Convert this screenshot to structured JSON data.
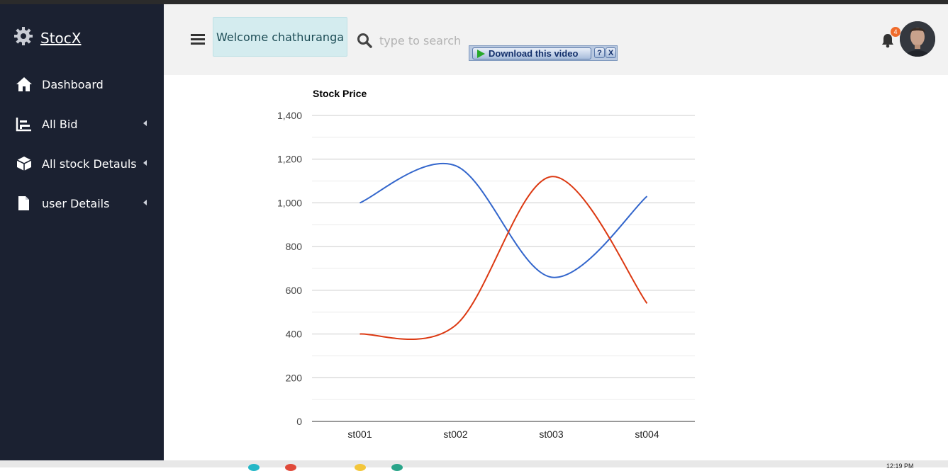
{
  "app": {
    "brand": "StocX"
  },
  "sidebar": {
    "items": [
      {
        "label": "Dashboard",
        "icon": "home-icon",
        "has_caret": false
      },
      {
        "label": "All Bid",
        "icon": "bar-chart-icon",
        "has_caret": true
      },
      {
        "label": "All stock Detauls",
        "icon": "box-icon",
        "has_caret": true
      },
      {
        "label": "user Details",
        "icon": "file-icon",
        "has_caret": true
      }
    ]
  },
  "header": {
    "welcome": "Welcome chathuranga",
    "search_placeholder": "type to search",
    "notification_count": "4"
  },
  "overlay": {
    "download_label": "Download this video",
    "help_label": "?",
    "close_label": "X"
  },
  "chart_data": {
    "type": "line",
    "title": "Stock Price",
    "categories": [
      "st001",
      "st002",
      "st003",
      "st004"
    ],
    "ylim": [
      0,
      1400
    ],
    "yticks": [
      0,
      200,
      400,
      600,
      800,
      1000,
      1200,
      1400
    ],
    "ytick_labels": [
      "0",
      "200",
      "400",
      "600",
      "800",
      "1,000",
      "1,200",
      "1,400"
    ],
    "grid": true,
    "legend": "none",
    "series": [
      {
        "values": [
          1000,
          1170,
          660,
          1030
        ],
        "color": "#3366cc"
      },
      {
        "values": [
          400,
          440,
          1120,
          540
        ],
        "color": "#dc3912"
      }
    ]
  },
  "taskbar": {
    "time": "12:19 PM"
  }
}
